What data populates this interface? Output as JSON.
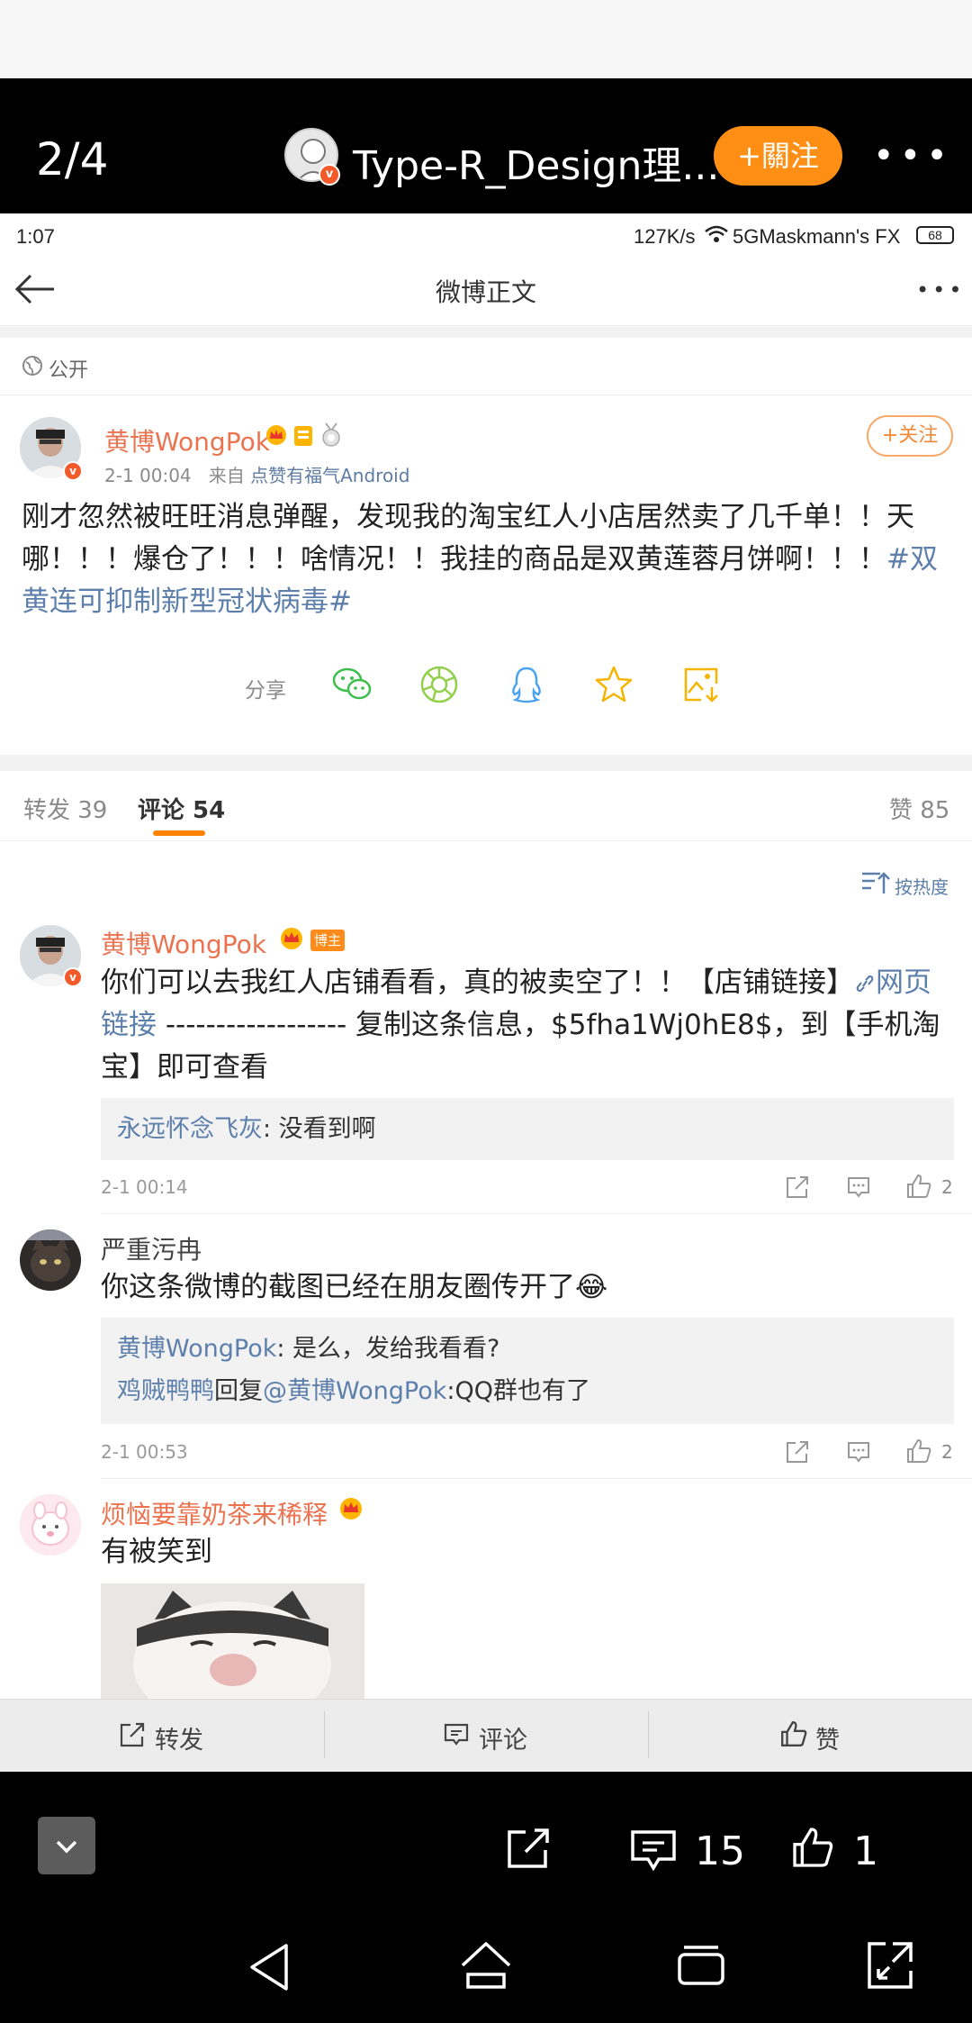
{
  "viewer": {
    "counter": "2/4",
    "account_name": "Type-R_Design理...",
    "follow_label": "+關注",
    "more": "•••",
    "comment_count": "15",
    "like_count": "1"
  },
  "status_bar": {
    "time": "1:07",
    "speed": "127K/s",
    "network": "5GMaskmann's FX",
    "battery": "68"
  },
  "nav": {
    "title": "微博正文"
  },
  "post": {
    "visibility": "公开",
    "author": "黄博WongPok",
    "time": "2-1 00:04",
    "source_prefix": "来自",
    "source": "点赞有福气Android",
    "follow_label": "+关注",
    "text": "刚才忽然被旺旺消息弹醒，发现我的淘宝红人小店居然卖了几千单！！天哪！！！爆仓了！！！啥情况！！我挂的商品是双黄莲蓉月饼啊！！！",
    "hashtag": "#双黄连可抑制新型冠状病毒#",
    "share_label": "分享"
  },
  "tabs": {
    "repost": "转发 39",
    "comment": "评论 54",
    "like": "赞 85"
  },
  "sort_label": "按热度",
  "comments": [
    {
      "name": "黄博WongPok",
      "badge": "博主",
      "text_a": "你们可以去我红人店铺看看，真的被卖空了！！【店铺链接】",
      "link": "网页链接",
      "text_b": " ------------------ 复制这条信息，$5fha1Wj0hE8$，到【手机淘宝】即可查看",
      "reply_user": "永远怀念飞灰",
      "reply_text": ": 没看到啊",
      "time": "2-1 00:14",
      "likes": "2"
    },
    {
      "name": "严重污冉",
      "text": "你这条微博的截图已经在朋友圈传开了😂",
      "reply1_user": "黄博WongPok",
      "reply1_text": ": 是么，发给我看看?",
      "reply2_user": "鸡贼鸭鸭",
      "reply2_mid": "回复",
      "reply2_at": "@黄博WongPok",
      "reply2_text": ":QQ群也有了",
      "time": "2-1 00:53",
      "likes": "2"
    },
    {
      "name": "烦恼要靠奶茶来稀释",
      "text": "有被笑到"
    }
  ],
  "bottom_actions": {
    "repost": "转发",
    "comment": "评论",
    "like": "赞"
  },
  "colors": {
    "orange": "#ff8f14",
    "username": "#eb7350",
    "link": "#5d7fab"
  }
}
